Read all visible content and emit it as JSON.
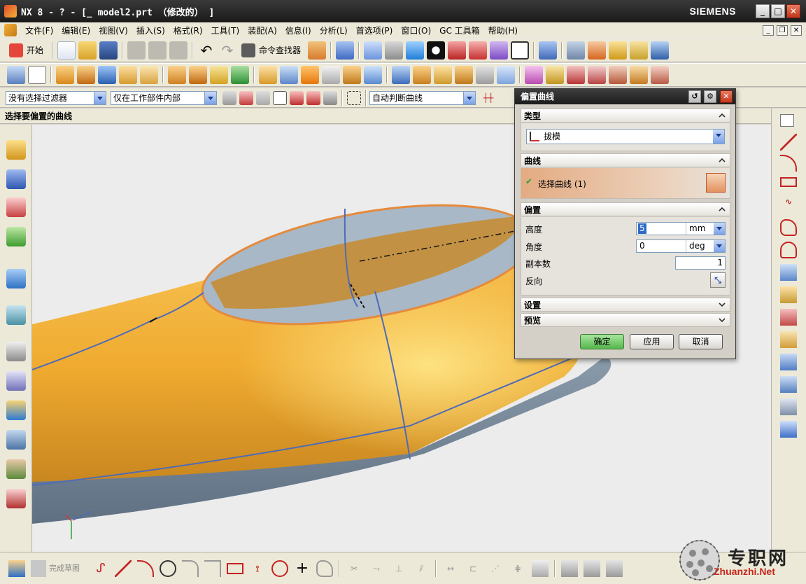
{
  "window": {
    "title": "NX 8 - ? - [_ model2.prt （修改的） ]",
    "brand": "SIEMENS",
    "minimize": "_",
    "maximize": "□",
    "close": "✕"
  },
  "menubar": {
    "items": [
      "文件(F)",
      "编辑(E)",
      "视图(V)",
      "插入(S)",
      "格式(R)",
      "工具(T)",
      "装配(A)",
      "信息(I)",
      "分析(L)",
      "首选项(P)",
      "窗口(O)",
      "GC 工具箱",
      "帮助(H)"
    ]
  },
  "toolbar1": {
    "start_label": "开始",
    "command_finder_label": "命令查找器"
  },
  "selection_bar": {
    "filter": "没有选择过滤器",
    "scope": "仅在工作部件内部",
    "curve_rule": "自动判断曲线"
  },
  "cue_line": "选择要偏置的曲线",
  "dialog": {
    "title": "偏置曲线",
    "groups": {
      "type": {
        "header": "类型",
        "value": "拔模"
      },
      "curve": {
        "header": "曲线",
        "select_label": "选择曲线 (1)"
      },
      "offset": {
        "header": "偏置",
        "height_label": "高度",
        "height_value": "5",
        "height_unit": "mm",
        "angle_label": "角度",
        "angle_value": "0",
        "angle_unit": "deg",
        "copies_label": "副本数",
        "copies_value": "1",
        "reverse_label": "反向"
      },
      "settings": {
        "header": "设置"
      },
      "preview": {
        "header": "预览"
      }
    },
    "buttons": {
      "ok": "确定",
      "apply": "应用",
      "cancel": "取消"
    }
  },
  "bottom_toolbar": {
    "finish_sketch_label": "完成草图"
  },
  "watermark": {
    "text": "专职网",
    "url": "Zhuanzhi.Net"
  },
  "colors": {
    "model_yellow": "#f0b43c",
    "model_shadow": "#c8871f",
    "model_base": "#7d8ea0",
    "curve_blue": "#4e6bb8",
    "dialog_highlight": "#e3ab82"
  }
}
